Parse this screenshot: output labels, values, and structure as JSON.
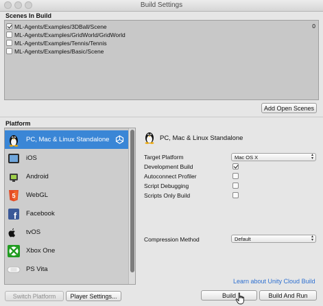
{
  "window": {
    "title": "Build Settings"
  },
  "scenes": {
    "header": "Scenes In Build",
    "items": [
      {
        "path": "ML-Agents/Examples/3DBall/Scene",
        "checked": true,
        "index": "0"
      },
      {
        "path": "ML-Agents/Examples/GridWorld/GridWorld",
        "checked": false,
        "index": ""
      },
      {
        "path": "ML-Agents/Examples/Tennis/Tennis",
        "checked": false,
        "index": ""
      },
      {
        "path": "ML-Agents/Examples/Basic/Scene",
        "checked": false,
        "index": ""
      }
    ],
    "add_open_scenes_label": "Add Open Scenes"
  },
  "platform": {
    "header": "Platform",
    "items": [
      {
        "label": "PC, Mac & Linux Standalone",
        "icon": "linux-penguin-icon",
        "selected": true
      },
      {
        "label": "iOS",
        "icon": "ios-device-icon",
        "selected": false
      },
      {
        "label": "Android",
        "icon": "android-icon",
        "selected": false
      },
      {
        "label": "WebGL",
        "icon": "html5-icon",
        "selected": false
      },
      {
        "label": "Facebook",
        "icon": "facebook-icon",
        "selected": false
      },
      {
        "label": "tvOS",
        "icon": "apple-tv-icon",
        "selected": false
      },
      {
        "label": "Xbox One",
        "icon": "xbox-icon",
        "selected": false
      },
      {
        "label": "PS Vita",
        "icon": "ps-vita-icon",
        "selected": false
      }
    ]
  },
  "settings": {
    "title": "PC, Mac & Linux Standalone",
    "target_platform_label": "Target Platform",
    "target_platform_value": "Mac OS X",
    "development_build_label": "Development Build",
    "development_build": true,
    "autoconnect_profiler_label": "Autoconnect Profiler",
    "autoconnect_profiler": false,
    "script_debugging_label": "Script Debugging",
    "script_debugging": false,
    "scripts_only_build_label": "Scripts Only Build",
    "scripts_only_build": false,
    "compression_method_label": "Compression Method",
    "compression_method_value": "Default"
  },
  "footer": {
    "cloud_build_link": "Learn about Unity Cloud Build",
    "switch_platform_label": "Switch Platform",
    "player_settings_label": "Player Settings...",
    "build_label": "Build",
    "build_and_run_label": "Build And Run"
  },
  "colors": {
    "selection": "#3a86d6",
    "link": "#2d6fd0",
    "background": "#e6e6e6"
  }
}
